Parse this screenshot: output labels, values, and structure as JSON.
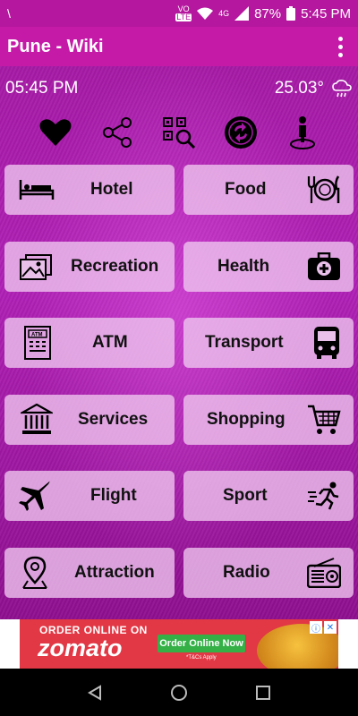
{
  "status_bar": {
    "carrier_indicator": "\\",
    "volte": "VO",
    "lte": "LTE",
    "network": "4G",
    "battery": "87%",
    "time": "5:45 PM"
  },
  "app_bar": {
    "title": "Pune - Wiki"
  },
  "info": {
    "time": "05:45 PM",
    "temperature": "25.03°"
  },
  "quick_actions": [
    "favorite-icon",
    "share-icon",
    "qr-scan-icon",
    "sync-icon",
    "location-person-icon"
  ],
  "categories": [
    {
      "label": "Hotel",
      "icon": "bed-icon"
    },
    {
      "label": "Food",
      "icon": "food-plate-icon"
    },
    {
      "label": "Recreation",
      "icon": "pictures-icon"
    },
    {
      "label": "Health",
      "icon": "medical-kit-icon"
    },
    {
      "label": "ATM",
      "icon": "atm-icon"
    },
    {
      "label": "Transport",
      "icon": "bus-icon"
    },
    {
      "label": "Services",
      "icon": "bank-icon"
    },
    {
      "label": "Shopping",
      "icon": "cart-icon"
    },
    {
      "label": "Flight",
      "icon": "airplane-icon"
    },
    {
      "label": "Sport",
      "icon": "runner-icon"
    },
    {
      "label": "Attraction",
      "icon": "map-pin-icon"
    },
    {
      "label": "Radio",
      "icon": "radio-icon"
    }
  ],
  "ad": {
    "headline": "ORDER ONLINE ON",
    "brand": "zomato",
    "cta": "Order Online Now",
    "terms": "*T&Cs Apply"
  },
  "colors": {
    "status": "#b5179e",
    "appbar": "#c51aa8",
    "accent": "#a61aa6"
  }
}
